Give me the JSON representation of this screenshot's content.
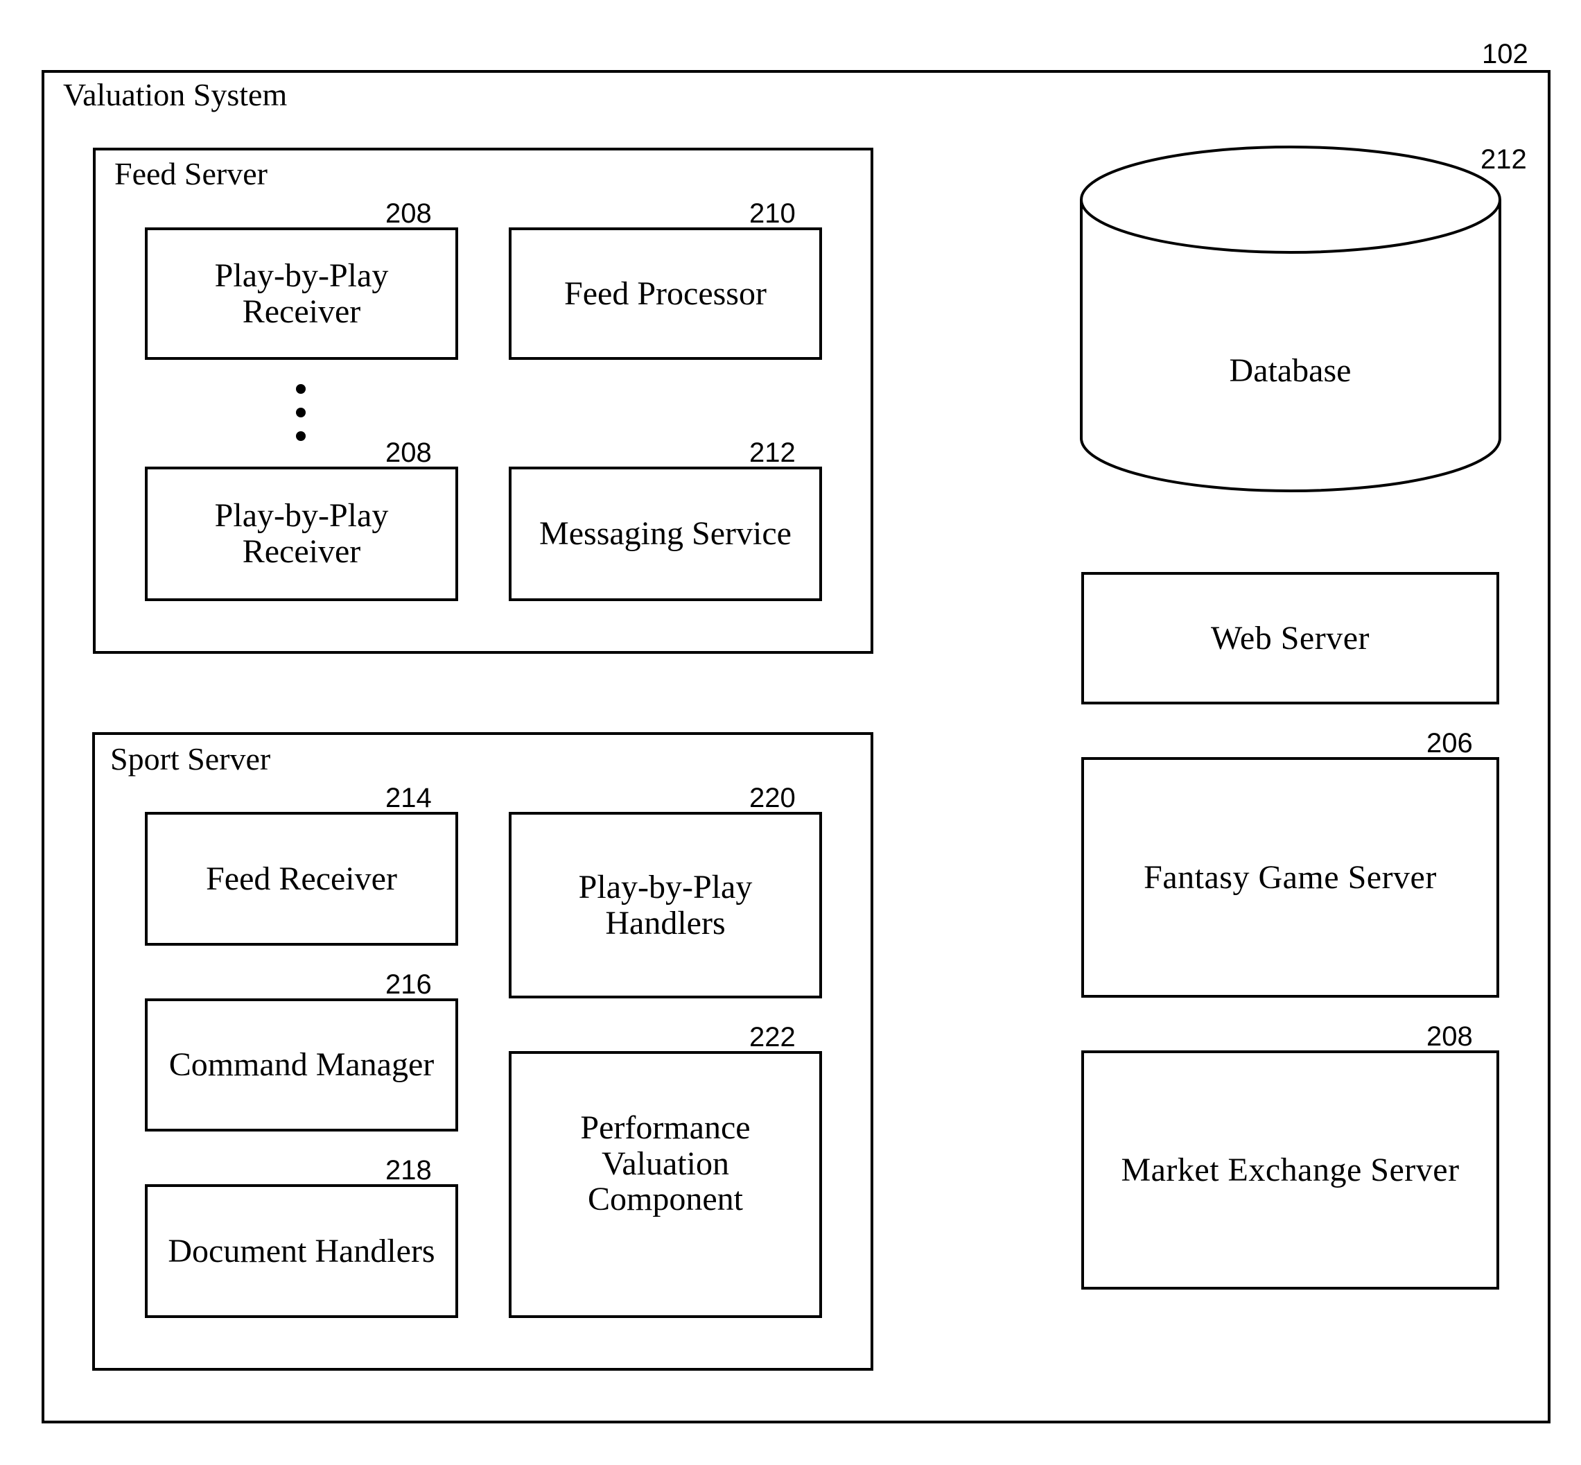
{
  "diagram": {
    "valuation_system": {
      "title": "Valuation System",
      "ref": "102"
    },
    "feed_server": {
      "title": "Feed Server",
      "components": [
        {
          "label": "Play-by-Play\nReceiver",
          "ref": "208"
        },
        {
          "label": "Feed Processor",
          "ref": "210"
        },
        {
          "label": "Play-by-Play\nReceiver",
          "ref": "208"
        },
        {
          "label": "Messaging Service",
          "ref": "212"
        }
      ],
      "ellipsis": "vertical-dots"
    },
    "sport_server": {
      "title": "Sport Server",
      "components": [
        {
          "label": "Feed Receiver",
          "ref": "214"
        },
        {
          "label": "Command Manager",
          "ref": "216"
        },
        {
          "label": "Document Handlers",
          "ref": "218"
        },
        {
          "label": "Play-by-Play\nHandlers",
          "ref": "220"
        },
        {
          "label": "Performance\nValuation\nComponent",
          "ref": "222"
        }
      ]
    },
    "database": {
      "label": "Database",
      "ref": "212",
      "shape": "cylinder"
    },
    "web_server": {
      "label": "Web Server"
    },
    "fantasy_game_server": {
      "label": "Fantasy Game Server",
      "ref": "206"
    },
    "market_exchange_server": {
      "label": "Market Exchange Server",
      "ref": "208"
    }
  }
}
